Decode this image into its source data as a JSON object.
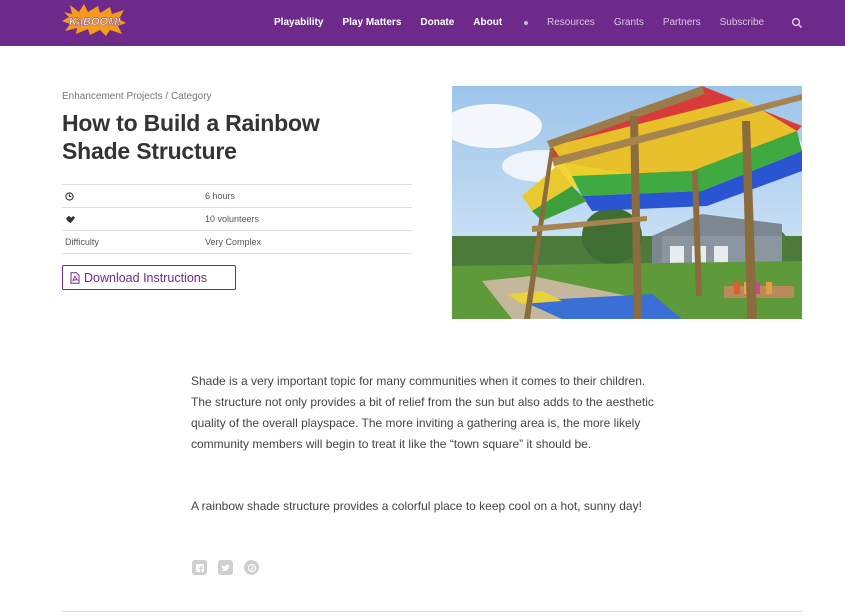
{
  "nav": {
    "logo_text": "KaBOOM!",
    "primary": [
      "Playability",
      "Play Matters",
      "Donate",
      "About"
    ],
    "secondary": [
      "Resources",
      "Grants",
      "Partners",
      "Subscribe"
    ],
    "search_icon": "search-icon"
  },
  "page": {
    "breadcrumb": "Enhancement Projects / Category",
    "title": "How to Build a Rainbow Shade Structure",
    "facts": [
      {
        "icon": "clock-icon",
        "value": "6 hours"
      },
      {
        "icon": "handshake-icon",
        "value": "10 volunteers"
      },
      {
        "label": "Difficulty",
        "value": "Very Complex"
      }
    ],
    "download_label": "Download Instructions"
  },
  "body": {
    "paragraph1": "Shade is a very important topic for many communities when it comes to their children. The structure not only provides a bit of relief from the sun but also adds to the aesthetic quality of the overall playspace. The more inviting a gathering area is, the more likely community members will begin to treat it like the “town square” it should be.",
    "paragraph2": "A rainbow shade structure provides a colorful place to keep cool on a hot, sunny day!"
  },
  "share": [
    "facebook-icon",
    "twitter-icon",
    "pinterest-icon"
  ],
  "colors": {
    "brand_purple": "#6e2a8a",
    "logo_orange": "#f39a1f"
  }
}
